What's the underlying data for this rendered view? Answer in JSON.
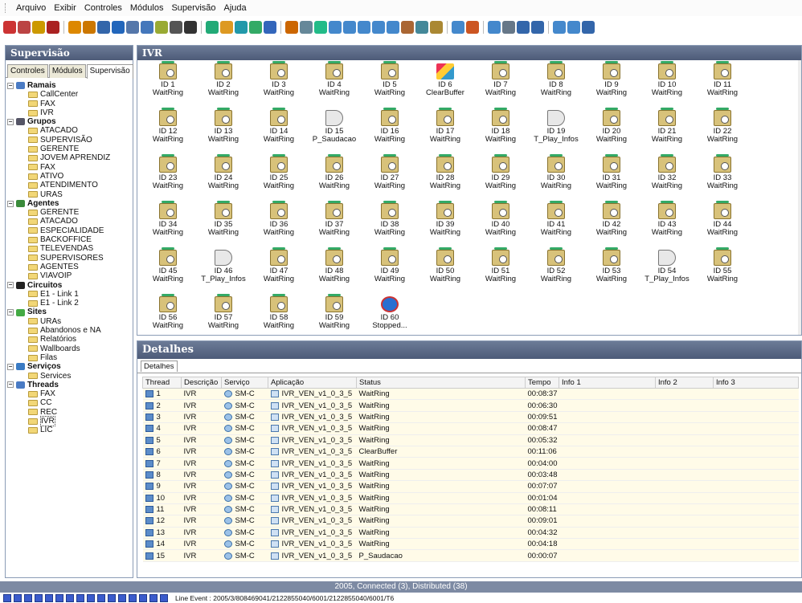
{
  "menu": [
    "Arquivo",
    "Exibir",
    "Controles",
    "Módulos",
    "Supervisão",
    "Ajuda"
  ],
  "toolbar": {
    "icons": [
      {
        "name": "back-icon",
        "color": "#c33"
      },
      {
        "name": "check-icon",
        "color": "#b44"
      },
      {
        "name": "folder-icon",
        "color": "#c90"
      },
      {
        "name": "user-icon",
        "color": "#a22"
      },
      {
        "name": "sep"
      },
      {
        "name": "tool-icon",
        "color": "#d80"
      },
      {
        "name": "config-icon",
        "color": "#c70"
      },
      {
        "name": "grid-icon",
        "color": "#36a"
      },
      {
        "name": "chart-icon",
        "color": "#26b"
      },
      {
        "name": "group-icon",
        "color": "#57a"
      },
      {
        "name": "table-icon",
        "color": "#47b"
      },
      {
        "name": "sheet-icon",
        "color": "#9a3"
      },
      {
        "name": "monitor-icon",
        "color": "#555"
      },
      {
        "name": "terminal-icon",
        "color": "#333"
      },
      {
        "name": "sep"
      },
      {
        "name": "network-icon",
        "color": "#2a7"
      },
      {
        "name": "gear-icon",
        "color": "#d92"
      },
      {
        "name": "calendar-icon",
        "color": "#29a"
      },
      {
        "name": "settings-icon",
        "color": "#3a6"
      },
      {
        "name": "list-icon",
        "color": "#36b"
      },
      {
        "name": "sep"
      },
      {
        "name": "link-icon",
        "color": "#c60"
      },
      {
        "name": "cog-icon",
        "color": "#689"
      },
      {
        "name": "queue-icon",
        "color": "#2b8"
      },
      {
        "name": "report-icon",
        "color": "#48c"
      },
      {
        "name": "report2-icon",
        "color": "#48c"
      },
      {
        "name": "report3-icon",
        "color": "#48c"
      },
      {
        "name": "report4-icon",
        "color": "#48c"
      },
      {
        "name": "report5-icon",
        "color": "#48c"
      },
      {
        "name": "users-icon",
        "color": "#a63"
      },
      {
        "name": "grid2-icon",
        "color": "#489"
      },
      {
        "name": "db-icon",
        "color": "#a83"
      },
      {
        "name": "sep"
      },
      {
        "name": "export-icon",
        "color": "#48c"
      },
      {
        "name": "edit-icon",
        "color": "#c52"
      },
      {
        "name": "sep"
      },
      {
        "name": "doc-icon",
        "color": "#48c"
      },
      {
        "name": "print-icon",
        "color": "#678"
      },
      {
        "name": "zoom-in-icon",
        "color": "#36a"
      },
      {
        "name": "zoom-out-icon",
        "color": "#36a"
      },
      {
        "name": "sep"
      },
      {
        "name": "page-icon",
        "color": "#48c"
      },
      {
        "name": "page2-icon",
        "color": "#48c"
      },
      {
        "name": "add-icon",
        "color": "#36a"
      }
    ]
  },
  "left": {
    "title": "Supervisão",
    "tabs": [
      "Controles",
      "Módulos",
      "Supervisão"
    ],
    "active_tab": 2,
    "tree": [
      {
        "label": "Ramais",
        "color": "#4a7bc4",
        "children": [
          "CallCenter",
          "FAX",
          "IVR"
        ]
      },
      {
        "label": "Grupos",
        "color": "#556",
        "children": [
          "ATACADO",
          "SUPERVISÃO",
          "GERENTE",
          "JOVEM APRENDIZ",
          "FAX",
          "ATIVO",
          "ATENDIMENTO",
          "URAS"
        ]
      },
      {
        "label": "Agentes",
        "color": "#3a8a3a",
        "children": [
          "GERENTE",
          "ATACADO",
          "ESPECIALIDADE",
          "BACKOFFICE",
          "TELEVENDAS",
          "SUPERVISORES",
          "AGENTES",
          "VIAVOIP"
        ]
      },
      {
        "label": "Circuitos",
        "color": "#222",
        "children": [
          "E1 - Link 1",
          "E1 - Link 2"
        ]
      },
      {
        "label": "Sites",
        "color": "#4a4",
        "children": [
          "URAs",
          "Abandonos e NA",
          "Relatórios",
          "Wallboards",
          "Filas"
        ]
      },
      {
        "label": "Serviços",
        "color": "#3a7bc4",
        "children": [
          "Services"
        ]
      },
      {
        "label": "Threads",
        "color": "#4a7bc4",
        "children": [
          "FAX",
          "CC",
          "REC",
          "IVR",
          "LIC"
        ],
        "selected": 3
      }
    ]
  },
  "ivr": {
    "title": "IVR",
    "items": [
      {
        "id": "ID 1",
        "status": "WaitRing",
        "icon": "wait"
      },
      {
        "id": "ID 2",
        "status": "WaitRing",
        "icon": "wait"
      },
      {
        "id": "ID 3",
        "status": "WaitRing",
        "icon": "wait"
      },
      {
        "id": "ID 4",
        "status": "WaitRing",
        "icon": "wait"
      },
      {
        "id": "ID 5",
        "status": "WaitRing",
        "icon": "wait"
      },
      {
        "id": "ID 6",
        "status": "ClearBuffer",
        "icon": "clear"
      },
      {
        "id": "ID 7",
        "status": "WaitRing",
        "icon": "wait"
      },
      {
        "id": "ID 8",
        "status": "WaitRing",
        "icon": "wait"
      },
      {
        "id": "ID 9",
        "status": "WaitRing",
        "icon": "wait"
      },
      {
        "id": "ID 10",
        "status": "WaitRing",
        "icon": "wait"
      },
      {
        "id": "ID 11",
        "status": "WaitRing",
        "icon": "wait"
      },
      {
        "id": "ID 12",
        "status": "WaitRing",
        "icon": "wait"
      },
      {
        "id": "ID 13",
        "status": "WaitRing",
        "icon": "wait"
      },
      {
        "id": "ID 14",
        "status": "WaitRing",
        "icon": "wait"
      },
      {
        "id": "ID 15",
        "status": "P_Saudacao",
        "icon": "play"
      },
      {
        "id": "ID 16",
        "status": "WaitRing",
        "icon": "wait"
      },
      {
        "id": "ID 17",
        "status": "WaitRing",
        "icon": "wait"
      },
      {
        "id": "ID 18",
        "status": "WaitRing",
        "icon": "wait"
      },
      {
        "id": "ID 19",
        "status": "T_Play_Infos",
        "icon": "play"
      },
      {
        "id": "ID 20",
        "status": "WaitRing",
        "icon": "wait"
      },
      {
        "id": "ID 21",
        "status": "WaitRing",
        "icon": "wait"
      },
      {
        "id": "ID 22",
        "status": "WaitRing",
        "icon": "wait"
      },
      {
        "id": "ID 23",
        "status": "WaitRing",
        "icon": "wait"
      },
      {
        "id": "ID 24",
        "status": "WaitRing",
        "icon": "wait"
      },
      {
        "id": "ID 25",
        "status": "WaitRing",
        "icon": "wait"
      },
      {
        "id": "ID 26",
        "status": "WaitRing",
        "icon": "wait"
      },
      {
        "id": "ID 27",
        "status": "WaitRing",
        "icon": "wait"
      },
      {
        "id": "ID 28",
        "status": "WaitRing",
        "icon": "wait"
      },
      {
        "id": "ID 29",
        "status": "WaitRing",
        "icon": "wait"
      },
      {
        "id": "ID 30",
        "status": "WaitRing",
        "icon": "wait"
      },
      {
        "id": "ID 31",
        "status": "WaitRing",
        "icon": "wait"
      },
      {
        "id": "ID 32",
        "status": "WaitRing",
        "icon": "wait"
      },
      {
        "id": "ID 33",
        "status": "WaitRing",
        "icon": "wait"
      },
      {
        "id": "ID 34",
        "status": "WaitRing",
        "icon": "wait"
      },
      {
        "id": "ID 35",
        "status": "WaitRing",
        "icon": "wait"
      },
      {
        "id": "ID 36",
        "status": "WaitRing",
        "icon": "wait"
      },
      {
        "id": "ID 37",
        "status": "WaitRing",
        "icon": "wait"
      },
      {
        "id": "ID 38",
        "status": "WaitRing",
        "icon": "wait"
      },
      {
        "id": "ID 39",
        "status": "WaitRing",
        "icon": "wait"
      },
      {
        "id": "ID 40",
        "status": "WaitRing",
        "icon": "wait"
      },
      {
        "id": "ID 41",
        "status": "WaitRing",
        "icon": "wait"
      },
      {
        "id": "ID 42",
        "status": "WaitRing",
        "icon": "wait"
      },
      {
        "id": "ID 43",
        "status": "WaitRing",
        "icon": "wait"
      },
      {
        "id": "ID 44",
        "status": "WaitRing",
        "icon": "wait"
      },
      {
        "id": "ID 45",
        "status": "WaitRing",
        "icon": "wait"
      },
      {
        "id": "ID 46",
        "status": "T_Play_Infos",
        "icon": "play"
      },
      {
        "id": "ID 47",
        "status": "WaitRing",
        "icon": "wait"
      },
      {
        "id": "ID 48",
        "status": "WaitRing",
        "icon": "wait"
      },
      {
        "id": "ID 49",
        "status": "WaitRing",
        "icon": "wait"
      },
      {
        "id": "ID 50",
        "status": "WaitRing",
        "icon": "wait"
      },
      {
        "id": "ID 51",
        "status": "WaitRing",
        "icon": "wait"
      },
      {
        "id": "ID 52",
        "status": "WaitRing",
        "icon": "wait"
      },
      {
        "id": "ID 53",
        "status": "WaitRing",
        "icon": "wait"
      },
      {
        "id": "ID 54",
        "status": "T_Play_Infos",
        "icon": "play"
      },
      {
        "id": "ID 55",
        "status": "WaitRing",
        "icon": "wait"
      },
      {
        "id": "ID 56",
        "status": "WaitRing",
        "icon": "wait"
      },
      {
        "id": "ID 57",
        "status": "WaitRing",
        "icon": "wait"
      },
      {
        "id": "ID 58",
        "status": "WaitRing",
        "icon": "wait"
      },
      {
        "id": "ID 59",
        "status": "WaitRing",
        "icon": "wait"
      },
      {
        "id": "ID 60",
        "status": "Stopped...",
        "icon": "stop"
      }
    ]
  },
  "details": {
    "title": "Detalhes",
    "tab": "Detalhes",
    "columns": [
      "Thread",
      "Descrição",
      "Serviço",
      "Aplicação",
      "Status",
      "Tempo",
      "Info 1",
      "Info 2",
      "Info 3"
    ],
    "rows": [
      [
        "1",
        "IVR",
        "SM-C",
        "IVR_VEN_v1_0_3_5",
        "WaitRing",
        "00:08:37"
      ],
      [
        "2",
        "IVR",
        "SM-C",
        "IVR_VEN_v1_0_3_5",
        "WaitRing",
        "00:06:30"
      ],
      [
        "3",
        "IVR",
        "SM-C",
        "IVR_VEN_v1_0_3_5",
        "WaitRing",
        "00:09:51"
      ],
      [
        "4",
        "IVR",
        "SM-C",
        "IVR_VEN_v1_0_3_5",
        "WaitRing",
        "00:08:47"
      ],
      [
        "5",
        "IVR",
        "SM-C",
        "IVR_VEN_v1_0_3_5",
        "WaitRing",
        "00:05:32"
      ],
      [
        "6",
        "IVR",
        "SM-C",
        "IVR_VEN_v1_0_3_5",
        "ClearBuffer",
        "00:11:06"
      ],
      [
        "7",
        "IVR",
        "SM-C",
        "IVR_VEN_v1_0_3_5",
        "WaitRing",
        "00:04:00"
      ],
      [
        "8",
        "IVR",
        "SM-C",
        "IVR_VEN_v1_0_3_5",
        "WaitRing",
        "00:03:48"
      ],
      [
        "9",
        "IVR",
        "SM-C",
        "IVR_VEN_v1_0_3_5",
        "WaitRing",
        "00:07:07"
      ],
      [
        "10",
        "IVR",
        "SM-C",
        "IVR_VEN_v1_0_3_5",
        "WaitRing",
        "00:01:04"
      ],
      [
        "11",
        "IVR",
        "SM-C",
        "IVR_VEN_v1_0_3_5",
        "WaitRing",
        "00:08:11"
      ],
      [
        "12",
        "IVR",
        "SM-C",
        "IVR_VEN_v1_0_3_5",
        "WaitRing",
        "00:09:01"
      ],
      [
        "13",
        "IVR",
        "SM-C",
        "IVR_VEN_v1_0_3_5",
        "WaitRing",
        "00:04:32"
      ],
      [
        "14",
        "IVR",
        "SM-C",
        "IVR_VEN_v1_0_3_5",
        "WaitRing",
        "00:04:18"
      ],
      [
        "15",
        "IVR",
        "SM-C",
        "IVR_VEN_v1_0_3_5",
        "P_Saudacao",
        "00:00:07"
      ]
    ]
  },
  "status_bar": "2005, Connected (3), Distributed (38)",
  "line_event": "Line Event : 2005/3/808469041/2122855040/6001/2122855040/6001/T6"
}
